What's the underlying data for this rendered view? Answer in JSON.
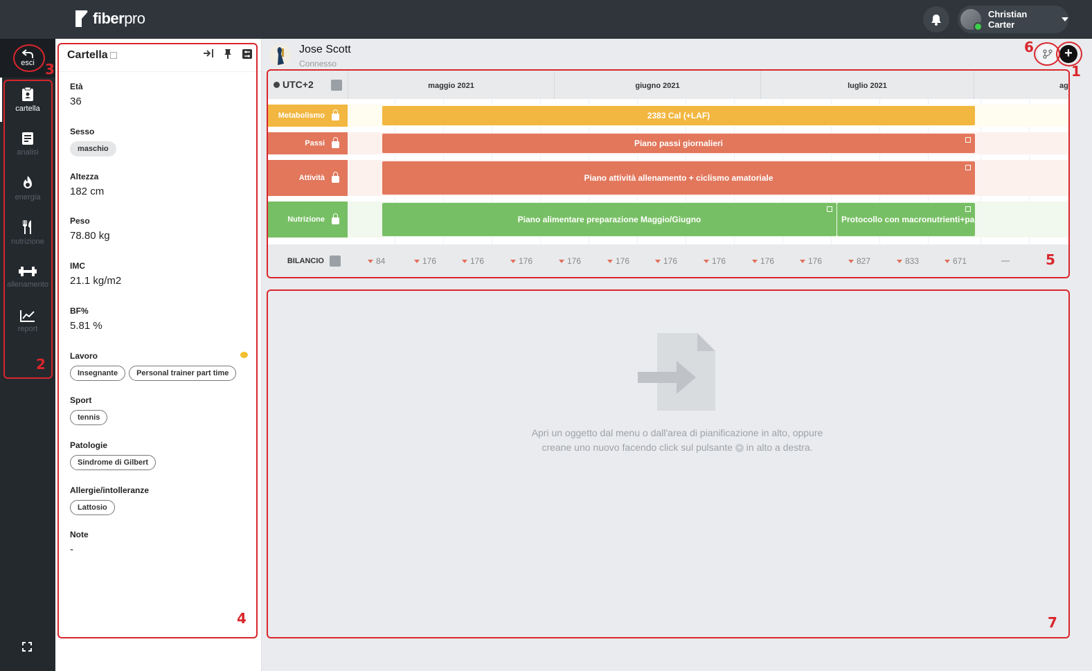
{
  "app": {
    "logo_bold": "fiber",
    "logo_light": "pro",
    "user_name": "Christian Carter"
  },
  "nav": {
    "exit": "esci",
    "items": [
      {
        "label": "cartella",
        "icon": "clipboard-icon",
        "active": true
      },
      {
        "label": "analisi",
        "icon": "document-icon",
        "active": false
      },
      {
        "label": "energia",
        "icon": "flame-icon",
        "active": false
      },
      {
        "label": "nutrizione",
        "icon": "fork-knife-icon",
        "active": false
      },
      {
        "label": "allenamento",
        "icon": "dumbbell-icon",
        "active": false
      },
      {
        "label": "report",
        "icon": "chart-line-icon",
        "active": false
      }
    ]
  },
  "cartella": {
    "title": "Cartella",
    "fields": {
      "eta": {
        "label": "Età",
        "value": "36"
      },
      "sesso": {
        "label": "Sesso",
        "value": "maschio"
      },
      "altezza": {
        "label": "Altezza",
        "value": "182 cm"
      },
      "peso": {
        "label": "Peso",
        "value": "78.80 kg"
      },
      "imc": {
        "label": "IMC",
        "value": "21.1 kg/m2"
      },
      "bf": {
        "label": "BF%",
        "value": "5.81 %"
      },
      "lavoro": {
        "label": "Lavoro",
        "tags": [
          "Insegnante",
          "Personal trainer part time"
        ]
      },
      "sport": {
        "label": "Sport",
        "tags": [
          "tennis"
        ]
      },
      "patologie": {
        "label": "Patologie",
        "tags": [
          "Sindrome di Gilbert"
        ]
      },
      "allergie": {
        "label": "Allergie/intolleranze",
        "tags": [
          "Lattosio"
        ]
      },
      "note": {
        "label": "Note",
        "value": "-"
      }
    }
  },
  "patient": {
    "name": "Jose Scott",
    "status": "Connesso"
  },
  "timeline": {
    "timezone": "UTC+2",
    "months": [
      "maggio 2021",
      "giugno 2021",
      "luglio 2021",
      "agosto"
    ],
    "lanes": [
      {
        "label": "Metabolismo",
        "color": "#f2b740",
        "bars": [
          {
            "label": "2383 Cal (+LAF)"
          }
        ]
      },
      {
        "label": "Passi",
        "color": "#e2775c",
        "bars": [
          {
            "label": "Piano passi giornalieri"
          }
        ]
      },
      {
        "label": "Attività",
        "color": "#e2775c",
        "bars": [
          {
            "label": "Piano attività allenamento + ciclismo amatoriale"
          }
        ]
      },
      {
        "label": "Nutrizione",
        "color": "#77bf64",
        "bars": [
          {
            "label": "Piano alimentare preparazione Maggio/Giugno"
          },
          {
            "label": "Protocollo con macronutrienti+pa"
          }
        ]
      }
    ],
    "bilancio_label": "BILANCIO",
    "bilancio_values": [
      "84",
      "176",
      "176",
      "176",
      "176",
      "176",
      "176",
      "176",
      "176",
      "176",
      "827",
      "833",
      "671"
    ]
  },
  "empty_state": {
    "line1": "Apri un oggetto dal menu o dall'area di pianificazione in alto, oppure",
    "line2_a": "creane uno nuovo facendo click sul pulsante",
    "line2_b": "in alto a destra."
  },
  "annotations": [
    "1",
    "2",
    "3",
    "4",
    "5",
    "6",
    "7"
  ],
  "colors": {
    "topbar": "#2f353b",
    "nav": "#24292e",
    "annotation": "#d9262c",
    "metabolismo": "#f2b740",
    "passi": "#e2775c",
    "nutrizione": "#77bf64"
  }
}
